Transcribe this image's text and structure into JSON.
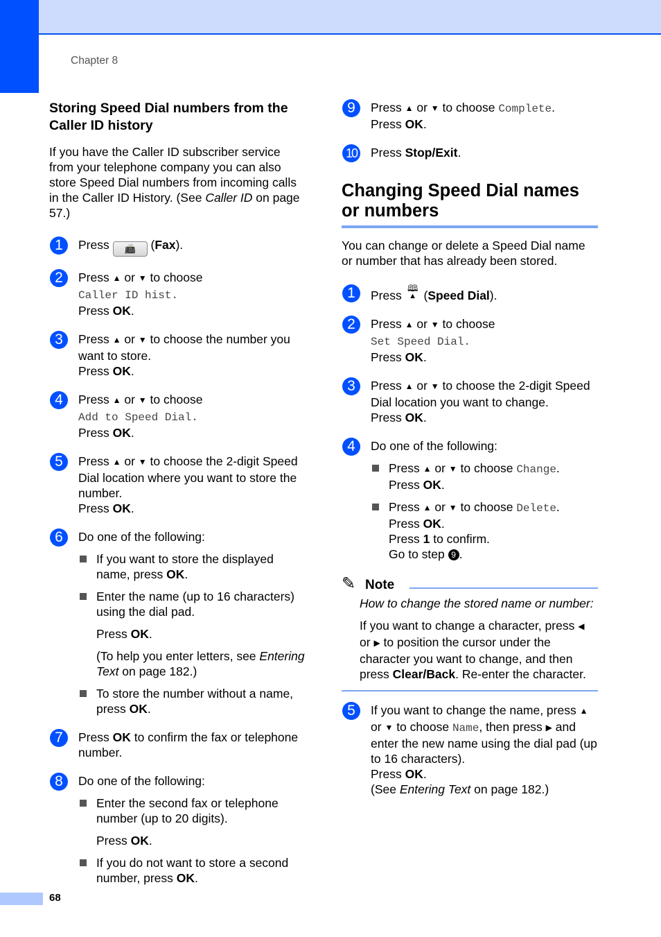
{
  "header": {
    "chapter": "Chapter 8"
  },
  "footer": {
    "page_number": "68"
  },
  "colors": {
    "accent": "#0050ff",
    "band": "#cddcfc",
    "rule": "#7ca6f4"
  },
  "left": {
    "heading": "Storing Speed Dial numbers from the Caller ID history",
    "intro_1": "If you have the Caller ID subscriber service from your telephone company you can also store Speed Dial numbers from incoming calls in the Caller ID History. (See ",
    "intro_link": "Caller ID",
    "intro_2": " on page 57.)",
    "steps": [
      {
        "num": "1",
        "press": "Press ",
        "icon": "fax-icon",
        "paren_open": " (",
        "key": "Fax",
        "paren_close": ")."
      },
      {
        "num": "2",
        "a": "Press ",
        "b": " or ",
        "c": " to choose",
        "mono": "Caller ID hist.",
        "press": "Press ",
        "ok": "OK",
        "end": "."
      },
      {
        "num": "3",
        "a": "Press ",
        "b": " or ",
        "c": " to choose the number you want to store.",
        "press": "Press ",
        "ok": "OK",
        "end": "."
      },
      {
        "num": "4",
        "a": "Press ",
        "b": " or ",
        "c": " to choose",
        "mono": "Add to Speed Dial.",
        "press": "Press ",
        "ok": "OK",
        "end": "."
      },
      {
        "num": "5",
        "a": "Press ",
        "b": " or ",
        "c": " to choose the 2-digit Speed Dial location where you want to store the number.",
        "press": "Press ",
        "ok": "OK",
        "end": "."
      },
      {
        "num": "6",
        "text": "Do one of the following:",
        "bullets": [
          {
            "a": "If you want to store the displayed name, press ",
            "ok": "OK",
            "end": "."
          },
          {
            "a": "Enter the name (up to 16 characters) using the dial pad.",
            "press": "Press ",
            "ok": "OK",
            "end": ".",
            "help_1": "(To help you enter letters, see ",
            "help_link": "Entering Text",
            "help_2": " on page 182.)"
          },
          {
            "a": "To store the number without a name, press ",
            "ok": "OK",
            "end": "."
          }
        ]
      },
      {
        "num": "7",
        "a": "Press ",
        "ok": "OK",
        "c": " to confirm the fax or telephone number."
      },
      {
        "num": "8",
        "text": "Do one of the following:",
        "bullets": [
          {
            "a": "Enter the second fax or telephone number (up to 20 digits).",
            "press": "Press ",
            "ok": "OK",
            "end": "."
          },
          {
            "a": "If you do not want to store a second number, press ",
            "ok": "OK",
            "end": "."
          }
        ]
      }
    ]
  },
  "right": {
    "steps_cont": [
      {
        "num": "9",
        "a": "Press ",
        "b": " or ",
        "c": " to choose ",
        "mono": "Complete",
        "d": ".",
        "press": "Press ",
        "ok": "OK",
        "end": "."
      },
      {
        "num": "10",
        "a": "Press ",
        "key": "Stop/Exit",
        "end": "."
      }
    ],
    "heading": "Changing Speed Dial names or numbers",
    "intro": "You can change or delete a Speed Dial name or number that has already been stored.",
    "steps": [
      {
        "num": "1",
        "a": "Press ",
        "icon": "speed-dial-icon",
        "paren_open": " (",
        "key": "Speed Dial",
        "paren_close": ")."
      },
      {
        "num": "2",
        "a": "Press ",
        "b": " or ",
        "c": " to choose",
        "mono": "Set Speed Dial.",
        "press": "Press ",
        "ok": "OK",
        "end": "."
      },
      {
        "num": "3",
        "a": "Press ",
        "b": " or ",
        "c": " to choose the 2-digit Speed Dial location you want to change.",
        "press": "Press ",
        "ok": "OK",
        "end": "."
      },
      {
        "num": "4",
        "text": "Do one of the following:",
        "bullets": [
          {
            "a": "Press ",
            "b": " or ",
            "c": " to choose ",
            "mono": "Change",
            "d": ".",
            "press": "Press ",
            "ok": "OK",
            "end": "."
          },
          {
            "a": "Press ",
            "b": " or ",
            "c": " to choose ",
            "mono": "Delete",
            "d": ".",
            "press": "Press ",
            "ok": "OK",
            "end": ".",
            "confirm_a": "Press ",
            "confirm_key": "1",
            "confirm_b": " to confirm.",
            "goto_a": "Go to step ",
            "goto_step": "9",
            "goto_b": "."
          }
        ]
      },
      {
        "num": "5",
        "a": "If you want to change the name, press ",
        "b": " or ",
        "c": " to choose ",
        "mono": "Name",
        "d": ", then press ",
        "e": " and enter the new name using the dial pad (up to 16 characters).",
        "press": "Press ",
        "ok": "OK",
        "end": ".",
        "see_a": "(See ",
        "see_link": "Entering Text",
        "see_b": " on page 182.)"
      }
    ],
    "note": {
      "title": "Note",
      "lead": "How to change the stored name or number:",
      "body_a": "If you want to change a character, press ",
      "body_b": " or ",
      "body_c": " to position the cursor under the character you want to change, and then press ",
      "body_key": "Clear/Back",
      "body_d": ". Re-enter the character."
    }
  },
  "glyphs": {
    "up": "▲",
    "down": "▼",
    "left": "◀",
    "right": "▶",
    "fax": "📠",
    "book": "🕮",
    "pencil": "✎"
  }
}
